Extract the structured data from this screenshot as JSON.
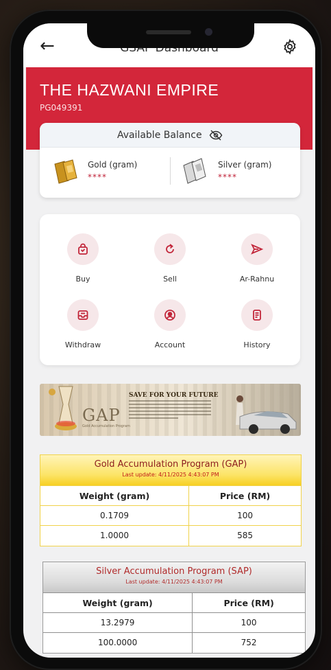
{
  "header": {
    "title": "GSAP Dashboard"
  },
  "account": {
    "name": "THE HAZWANI EMPIRE",
    "code": "PG049391"
  },
  "balance": {
    "title": "Available Balance",
    "gold": {
      "label": "Gold (gram)",
      "value": "****"
    },
    "silver": {
      "label": "Silver (gram)",
      "value": "****"
    }
  },
  "menu": {
    "buy": "Buy",
    "sell": "Sell",
    "arrahnu": "Ar-Rahnu",
    "withdraw": "Withdraw",
    "account": "Account",
    "history": "History"
  },
  "banner": {
    "headline": "SAVE FOR YOUR FUTURE",
    "logo": "GAP",
    "logo_sub": "Gold Accumulation Program"
  },
  "gap_table": {
    "title": "Gold Accumulation Program (GAP)",
    "updated": "Last update: 4/11/2025 4:43:07 PM",
    "col_weight": "Weight (gram)",
    "col_price": "Price (RM)",
    "rows": [
      {
        "weight": "0.1709",
        "price": "100"
      },
      {
        "weight": "1.0000",
        "price": "585"
      }
    ]
  },
  "sap_table": {
    "title": "Silver Accumulation Program (SAP)",
    "updated": "Last update: 4/11/2025 4:43:07 PM",
    "col_weight": "Weight (gram)",
    "col_price": "Price (RM)",
    "rows": [
      {
        "weight": "13.2979",
        "price": "100"
      },
      {
        "weight": "100.0000",
        "price": "752"
      }
    ]
  },
  "colors": {
    "brand_red": "#d3263a",
    "gold_border": "#f0d24a",
    "silver_border": "#9a9a9a"
  }
}
